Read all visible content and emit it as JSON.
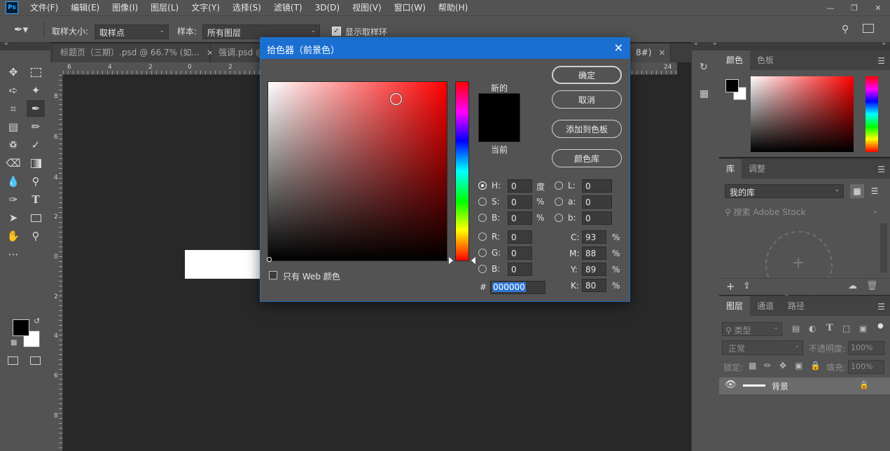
{
  "menubar": {
    "app_icon": "Ps",
    "items": [
      "文件(F)",
      "编辑(E)",
      "图像(I)",
      "图层(L)",
      "文字(Y)",
      "选择(S)",
      "滤镜(T)",
      "3D(D)",
      "视图(V)",
      "窗口(W)",
      "帮助(H)"
    ]
  },
  "options": {
    "sample_size_label": "取样大小:",
    "sample_size_value": "取样点",
    "sample_label": "样本:",
    "sample_value": "所有图层",
    "show_ring_label": "显示取样环"
  },
  "tabs": [
    {
      "label": "标题页（三期）.psd @ 66.7% (如...",
      "close": "×"
    },
    {
      "label": "强调.psd @",
      "close": ""
    },
    {
      "label": "8#)",
      "close": "×"
    }
  ],
  "ruler_h": [
    "6",
    "4",
    "2",
    "0",
    "2",
    "24"
  ],
  "ruler_v": [
    "8",
    "6",
    "4",
    "2",
    "0",
    "2",
    "4",
    "6",
    "8"
  ],
  "dialog": {
    "title": "拾色器（前景色）",
    "close": "✕",
    "new_label": "新的",
    "current_label": "当前",
    "buttons": {
      "ok": "确定",
      "cancel": "取消",
      "add_swatch": "添加到色板",
      "libraries": "颜色库"
    },
    "web_only_label": "只有 Web 颜色",
    "hsb": {
      "h_label": "H:",
      "h_value": "0",
      "h_unit": "度",
      "s_label": "S:",
      "s_value": "0",
      "s_unit": "%",
      "b_label": "B:",
      "b_value": "0",
      "b_unit": "%"
    },
    "rgb": {
      "r_label": "R:",
      "r_value": "0",
      "g_label": "G:",
      "g_value": "0",
      "b_label": "B:",
      "b_value": "0"
    },
    "lab": {
      "l_label": "L:",
      "l_value": "0",
      "a_label": "a:",
      "a_value": "0",
      "b_label": "b:",
      "b_value": "0"
    },
    "cmyk": {
      "c_label": "C:",
      "c_value": "93",
      "m_label": "M:",
      "m_value": "88",
      "y_label": "Y:",
      "y_value": "89",
      "k_label": "K:",
      "k_value": "80",
      "unit": "%"
    },
    "hex_label": "#",
    "hex_value": "000000",
    "selected_radio": "H",
    "hue_base_color": "#ff0000",
    "new_color": "#000000",
    "current_color": "#000000"
  },
  "panels": {
    "color": {
      "tabs": [
        "颜色",
        "色板"
      ]
    },
    "library": {
      "tabs": [
        "库",
        "调整"
      ],
      "library_select": "我的库",
      "search_placeholder": "搜索 Adobe Stock"
    },
    "layers": {
      "tabs": [
        "图层",
        "通道",
        "路径"
      ],
      "filter_label": "类型",
      "blend_mode": "正常",
      "opacity_label": "不透明度:",
      "opacity_value": "100%",
      "lock_label": "锁定:",
      "fill_label": "填充:",
      "fill_value": "100%",
      "layer_name": "背景"
    }
  },
  "accent_color": "#1a6fd1"
}
